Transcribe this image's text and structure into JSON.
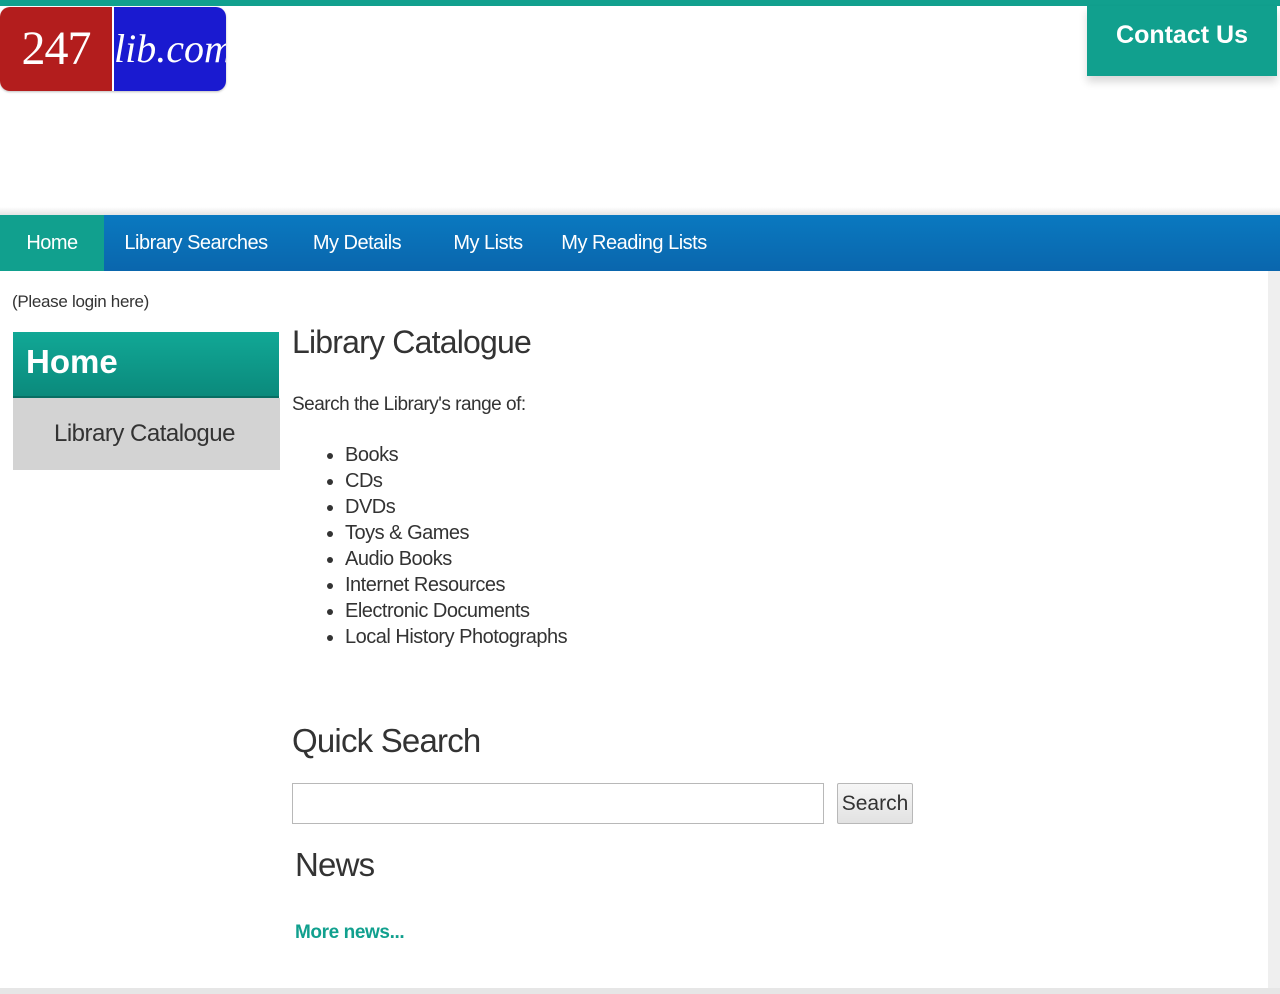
{
  "logo": {
    "left_text": "247",
    "right_text": "lib.com"
  },
  "header": {
    "contact_label": "Contact Us"
  },
  "nav": {
    "items": [
      {
        "label": "Home",
        "active": true
      },
      {
        "label": "Library Searches",
        "active": false
      },
      {
        "label": "My Details",
        "active": false
      },
      {
        "label": "My Lists",
        "active": false
      },
      {
        "label": "My Reading Lists",
        "active": false
      }
    ]
  },
  "login_note": "(Please login here)",
  "sidebar": {
    "title": "Home",
    "items": [
      {
        "label": "Library Catalogue"
      }
    ]
  },
  "main": {
    "title": "Library Catalogue",
    "intro": "Search the Library's range of:",
    "range_items": [
      "Books",
      "CDs",
      "DVDs",
      "Toys & Games",
      "Audio Books",
      "Internet Resources",
      "Electronic Documents",
      "Local History Photographs"
    ],
    "quick_search": {
      "title": "Quick Search",
      "input_value": "",
      "button_label": "Search"
    },
    "news": {
      "title": "News",
      "more_link": "More news..."
    }
  },
  "colors": {
    "accent_teal": "#11a08e",
    "nav_blue": "#0a72b8",
    "logo_red": "#b31d1d",
    "logo_blue": "#1a1ad0",
    "sidebar_grey": "#d3d3d3"
  }
}
